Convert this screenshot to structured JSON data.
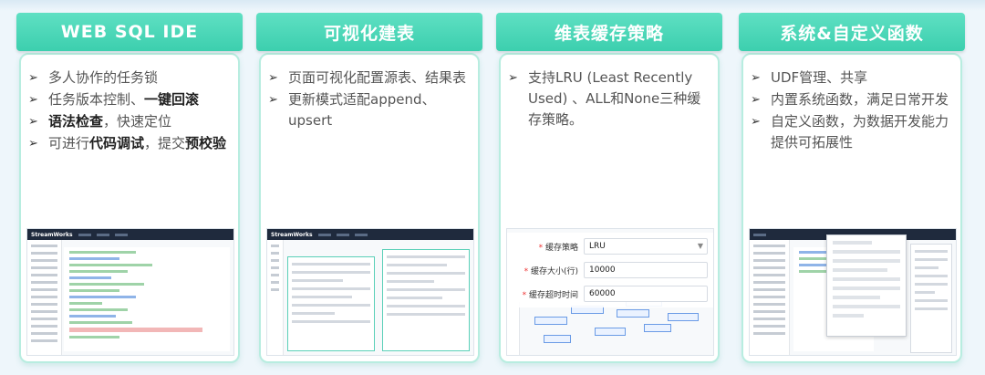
{
  "cards": [
    {
      "title": "WEB SQL IDE",
      "features": [
        {
          "parts": [
            {
              "t": "多人协作的任务锁",
              "b": false
            }
          ]
        },
        {
          "parts": [
            {
              "t": "任务版本控制、",
              "b": false
            },
            {
              "t": "一键回滚",
              "b": true
            }
          ]
        },
        {
          "parts": [
            {
              "t": "语法检查",
              "b": true
            },
            {
              "t": "，快速定位",
              "b": false
            }
          ]
        },
        {
          "parts": [
            {
              "t": "可进行",
              "b": false
            },
            {
              "t": "代码调试",
              "b": true
            },
            {
              "t": "，提交",
              "b": false
            },
            {
              "t": "预校验",
              "b": true
            }
          ]
        }
      ],
      "shot_logo": "StreamWorks"
    },
    {
      "title": "可视化建表",
      "features": [
        {
          "parts": [
            {
              "t": "页面可视化配置源表、结果表",
              "b": false
            }
          ]
        },
        {
          "parts": [
            {
              "t": "更新模式适配append、upsert",
              "b": false
            }
          ]
        }
      ],
      "shot_logo": "StreamWorks"
    },
    {
      "title": "维表缓存策略",
      "features": [
        {
          "parts": [
            {
              "t": "支持LRU (Least Recently Used) 、ALL和None三种缓存策略。",
              "b": false
            }
          ]
        }
      ],
      "form": [
        {
          "label": "缓存策略",
          "value": "LRU",
          "select": true
        },
        {
          "label": "缓存大小(行)",
          "value": "10000",
          "select": false
        },
        {
          "label": "缓存超时时间",
          "value": "60000",
          "select": false
        }
      ]
    },
    {
      "title": "系统&自定义函数",
      "features": [
        {
          "parts": [
            {
              "t": "UDF管理、共享",
              "b": false
            }
          ]
        },
        {
          "parts": [
            {
              "t": "内置系统函数，满足日常开发",
              "b": false
            }
          ]
        },
        {
          "parts": [
            {
              "t": "自定义函数，为数据开发能力提供可拓展性",
              "b": false
            }
          ]
        }
      ]
    }
  ],
  "icons": {
    "bullet": "arrow-bullet-icon",
    "select": "chevron-down-icon"
  },
  "colors": {
    "header": "#3ccfae",
    "card_border": "#b8ede0",
    "text": "#555555",
    "bold_text": "#222222"
  }
}
